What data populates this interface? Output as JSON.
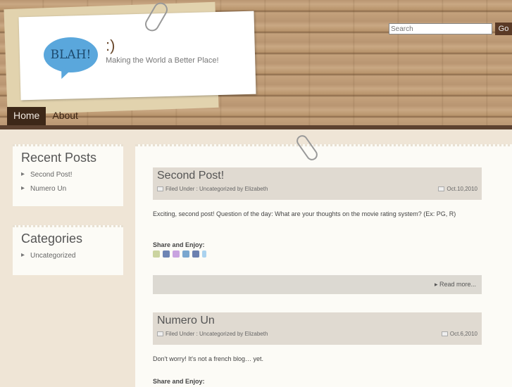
{
  "header": {
    "logo_text": "BLAH!",
    "site_title": ":)",
    "tagline": "Making the World a Better Place!",
    "search_placeholder": "Search",
    "go_label": "Go"
  },
  "nav": {
    "items": [
      {
        "label": "Home",
        "active": true
      },
      {
        "label": "About",
        "active": false
      }
    ]
  },
  "sidebar": {
    "recent": {
      "title": "Recent Posts",
      "items": [
        "Second Post!",
        "Numero Un"
      ]
    },
    "categories": {
      "title": "Categories",
      "items": [
        "Uncategorized"
      ]
    }
  },
  "posts": [
    {
      "title": "Second Post!",
      "meta": "Filed Under : Uncategorized by Elizabeth",
      "date": "Oct.10,2010",
      "excerpt": "Exciting, second post! Question of the day: What are your thoughts on the movie rating system? (Ex: PG, R)",
      "share_label": "Share and Enjoy:",
      "read_more": "Read more..."
    },
    {
      "title": "Numero Un",
      "meta": "Filed Under : Uncategorized by Elizabeth",
      "date": "Oct.6,2010",
      "excerpt": "Don't worry! It's not a french blog… yet.",
      "share_label": "Share and Enjoy:"
    }
  ],
  "share_icons": [
    "print-icon",
    "facebook-icon",
    "stumbleupon-icon",
    "linkedin-icon",
    "myspace-icon",
    "twitter-icon"
  ]
}
